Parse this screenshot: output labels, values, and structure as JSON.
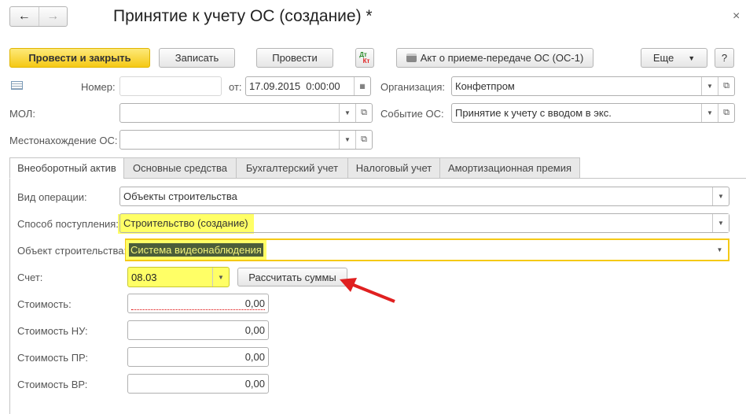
{
  "window": {
    "title": "Принятие к учету ОС (создание) *",
    "back": "←",
    "forward": "→",
    "close": "×"
  },
  "toolbar": {
    "post_close": "Провести и закрыть",
    "save": "Записать",
    "post": "Провести",
    "dt": "Дт",
    "kt": "Кт",
    "act": "Акт о приеме-передаче ОС (ОС-1)",
    "more": "Еще",
    "help": "?"
  },
  "header": {
    "number_label": "Номер:",
    "number_value": "",
    "date_label": "от:",
    "date_value": "17.09.2015  0:00:00",
    "org_label": "Организация:",
    "org_value": "Конфетпром",
    "mol_label": "МОЛ:",
    "mol_value": "",
    "event_label": "Событие ОС:",
    "event_value": "Принятие к учету с вводом в экс.",
    "location_label": "Местонахождение ОС:",
    "location_value": ""
  },
  "tabs": [
    "Внеоборотный актив",
    "Основные средства",
    "Бухгалтерский учет",
    "Налоговый учет",
    "Амортизационная премия"
  ],
  "asset": {
    "op_label": "Вид операции:",
    "op_value": "Объекты строительства",
    "method_label": "Способ поступления:",
    "method_value": "Строительство (создание)",
    "object_label": "Объект строительства:",
    "object_value": "Система видеонаблюдения",
    "account_label": "Счет:",
    "account_value": "08.03",
    "calc_button": "Рассчитать суммы",
    "cost_label": "Стоимость:",
    "cost_value": "0,00",
    "cost_nu_label": "Стоимость НУ:",
    "cost_nu_value": "0,00",
    "cost_pr_label": "Стоимость ПР:",
    "cost_pr_value": "0,00",
    "cost_vr_label": "Стоимость ВР:",
    "cost_vr_value": "0,00"
  },
  "colors": {
    "primary": "#f8d530",
    "highlight": "#ffff66",
    "arrow": "#e02020"
  }
}
